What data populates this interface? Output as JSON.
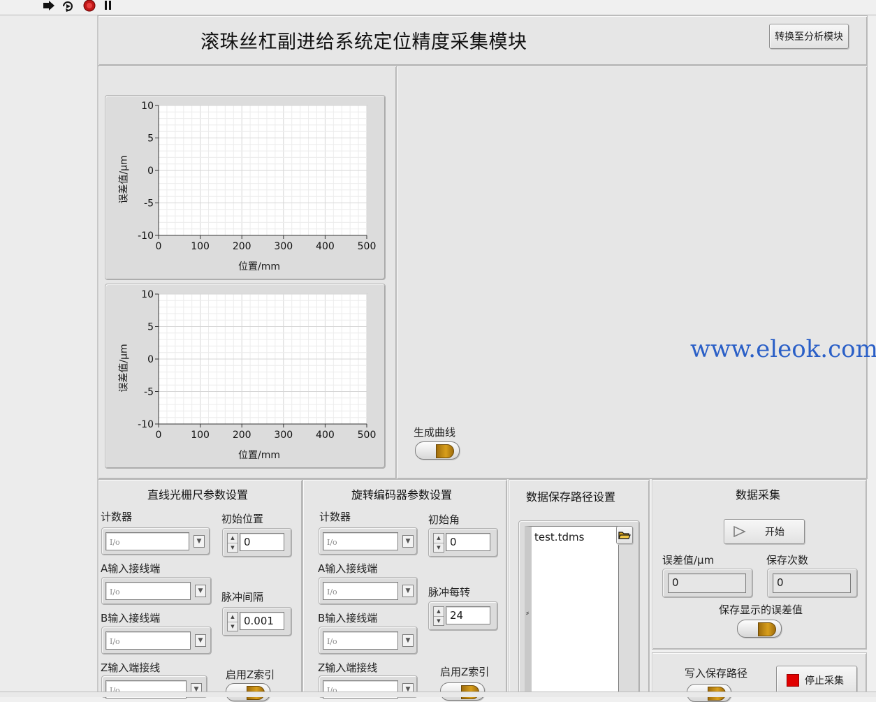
{
  "toolbar": {
    "run_icon": "run-arrow-icon",
    "run_continuous_icon": "run-continuously-icon",
    "abort_icon": "abort-stop-icon",
    "pause_icon": "pause-icon"
  },
  "header": {
    "title": "滚珠丝杠副进给系统定位精度采集模块",
    "switch_button_label": "转换至分析模块"
  },
  "charts_text": {
    "ylabel": "误差值/μm",
    "xlabel": "位置/mm"
  },
  "chart_data": [
    {
      "type": "line",
      "xlabel": "位置/mm",
      "ylabel": "误差值/μm",
      "xlim": [
        0,
        500
      ],
      "ylim": [
        -10,
        10
      ],
      "x_ticks": [
        0,
        100,
        200,
        300,
        400,
        500
      ],
      "y_ticks": [
        10,
        5,
        0,
        -5,
        -10
      ],
      "grid": true,
      "series": []
    },
    {
      "type": "line",
      "xlabel": "位置/mm",
      "ylabel": "误差值/μm",
      "xlim": [
        0,
        500
      ],
      "ylim": [
        -10,
        10
      ],
      "x_ticks": [
        0,
        100,
        200,
        300,
        400,
        500
      ],
      "y_ticks": [
        10,
        5,
        0,
        -5,
        -10
      ],
      "grid": true,
      "series": []
    }
  ],
  "generate_curve": {
    "label": "生成曲线"
  },
  "watermark": "www.eleok.com",
  "linear_scale": {
    "heading": "直线光栅尺参数设置",
    "counter_label": "计数器",
    "counter_value": "",
    "initial_pos_label": "初始位置",
    "initial_pos_value": "0",
    "a_input_label": "A输入接线端",
    "a_input_value": "",
    "pulse_interval_label": "脉冲间隔",
    "pulse_interval_value": "0.001",
    "b_input_label": "B输入接线端",
    "b_input_value": "",
    "z_input_label": "Z输入端接线",
    "z_input_value": "",
    "enable_z_label": "启用Z索引"
  },
  "rotary_encoder": {
    "heading": "旋转编码器参数设置",
    "counter_label": "计数器",
    "counter_value": "",
    "initial_angle_label": "初始角",
    "initial_angle_value": "0",
    "a_input_label": "A输入接线端",
    "a_input_value": "",
    "pulses_per_rev_label": "脉冲每转",
    "pulses_per_rev_value": "24",
    "b_input_label": "B输入接线端",
    "b_input_value": "",
    "z_input_label": "Z输入端接线",
    "z_input_value": "",
    "enable_z_label": "启用Z索引"
  },
  "save_path": {
    "heading": "数据保存路径设置",
    "path_value": "test.tdms"
  },
  "acquisition": {
    "heading": "数据采集",
    "start_label": "开始",
    "error_label": "误差值/μm",
    "error_value": "0",
    "save_count_label": "保存次数",
    "save_count_value": "0",
    "save_shown_label": "保存显示的误差值",
    "write_path_label": "写入保存路径",
    "stop_label": "停止采集"
  }
}
